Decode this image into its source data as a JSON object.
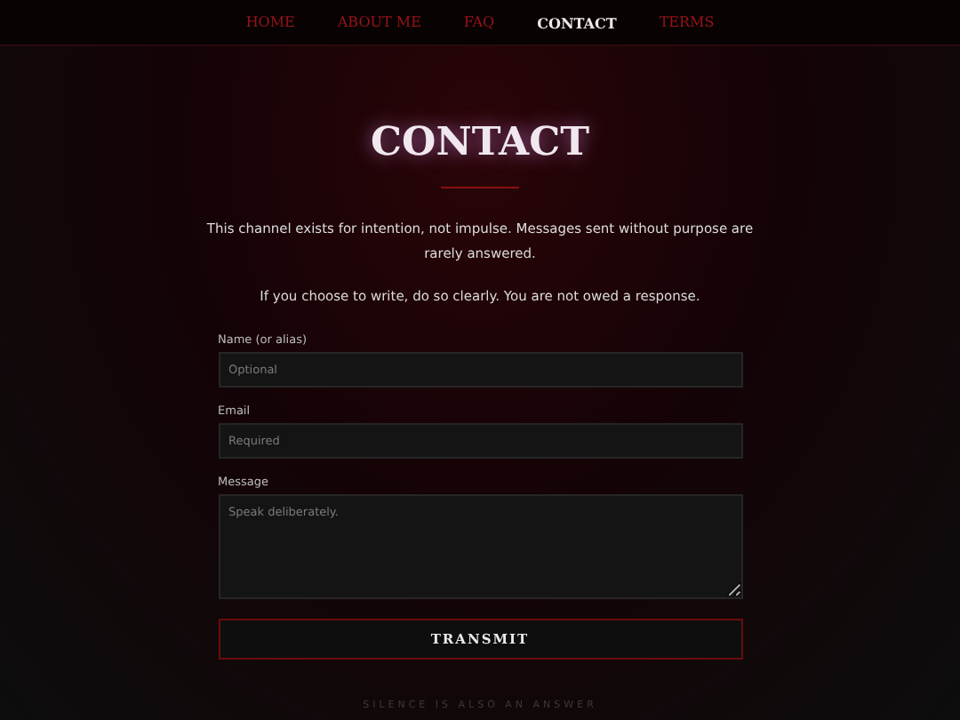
{
  "nav": [
    {
      "label": "HOME",
      "selected": false
    },
    {
      "label": "ABOUT ME",
      "selected": false
    },
    {
      "label": "FAQ",
      "selected": false
    },
    {
      "label": "CONTACT",
      "selected": true
    },
    {
      "label": "TERMS",
      "selected": false
    }
  ],
  "heading": "CONTACT",
  "intro": [
    "This channel exists for intention, not impulse. Messages sent without purpose are rarely answered.",
    "If you choose to write, do so clearly. You are not owed a response."
  ],
  "form": {
    "fields": [
      {
        "kind": "input",
        "label": "Name (or alias)",
        "placeholder": "Optional"
      },
      {
        "kind": "input",
        "label": "Email",
        "placeholder": "Required"
      },
      {
        "kind": "textarea",
        "label": "Message",
        "placeholder": "Speak deliberately."
      }
    ],
    "submit": "TRANSMIT"
  },
  "footer_note": "SILENCE IS ALSO AN ANSWER"
}
